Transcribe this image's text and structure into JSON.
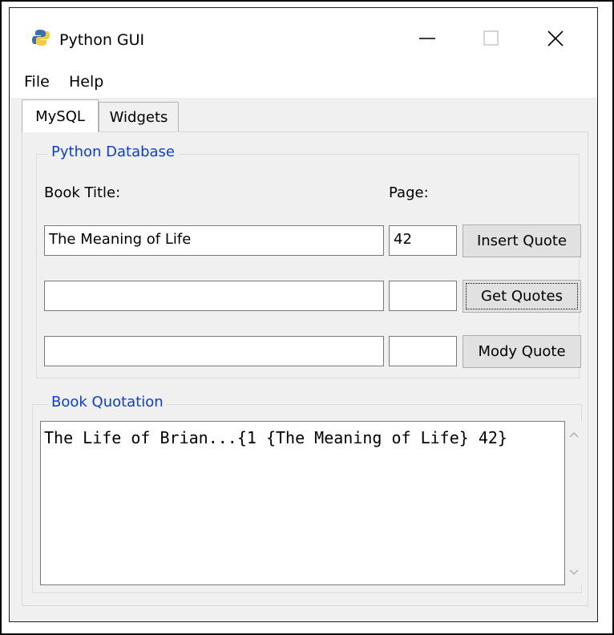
{
  "window": {
    "title": "Python GUI"
  },
  "menu": {
    "items": [
      "File",
      "Help"
    ]
  },
  "tabs": [
    {
      "label": "MySQL",
      "active": true
    },
    {
      "label": "Widgets",
      "active": false
    }
  ],
  "database_group": {
    "legend": "Python Database",
    "book_title_label": "Book Title:",
    "page_label": "Page:",
    "rows": [
      {
        "title_value": "The Meaning of Life",
        "page_value": "42",
        "button_label": "Insert Quote"
      },
      {
        "title_value": "",
        "page_value": "",
        "button_label": "Get Quotes"
      },
      {
        "title_value": "",
        "page_value": "",
        "button_label": "Mody Quote"
      }
    ]
  },
  "quotation_group": {
    "legend": "Book Quotation",
    "text": "The Life of Brian...{1 {The Meaning of Life} 42}"
  },
  "colors": {
    "accent": "#0a3ed8",
    "panel": "#f0f0f0",
    "button": "#e1e1e1"
  }
}
